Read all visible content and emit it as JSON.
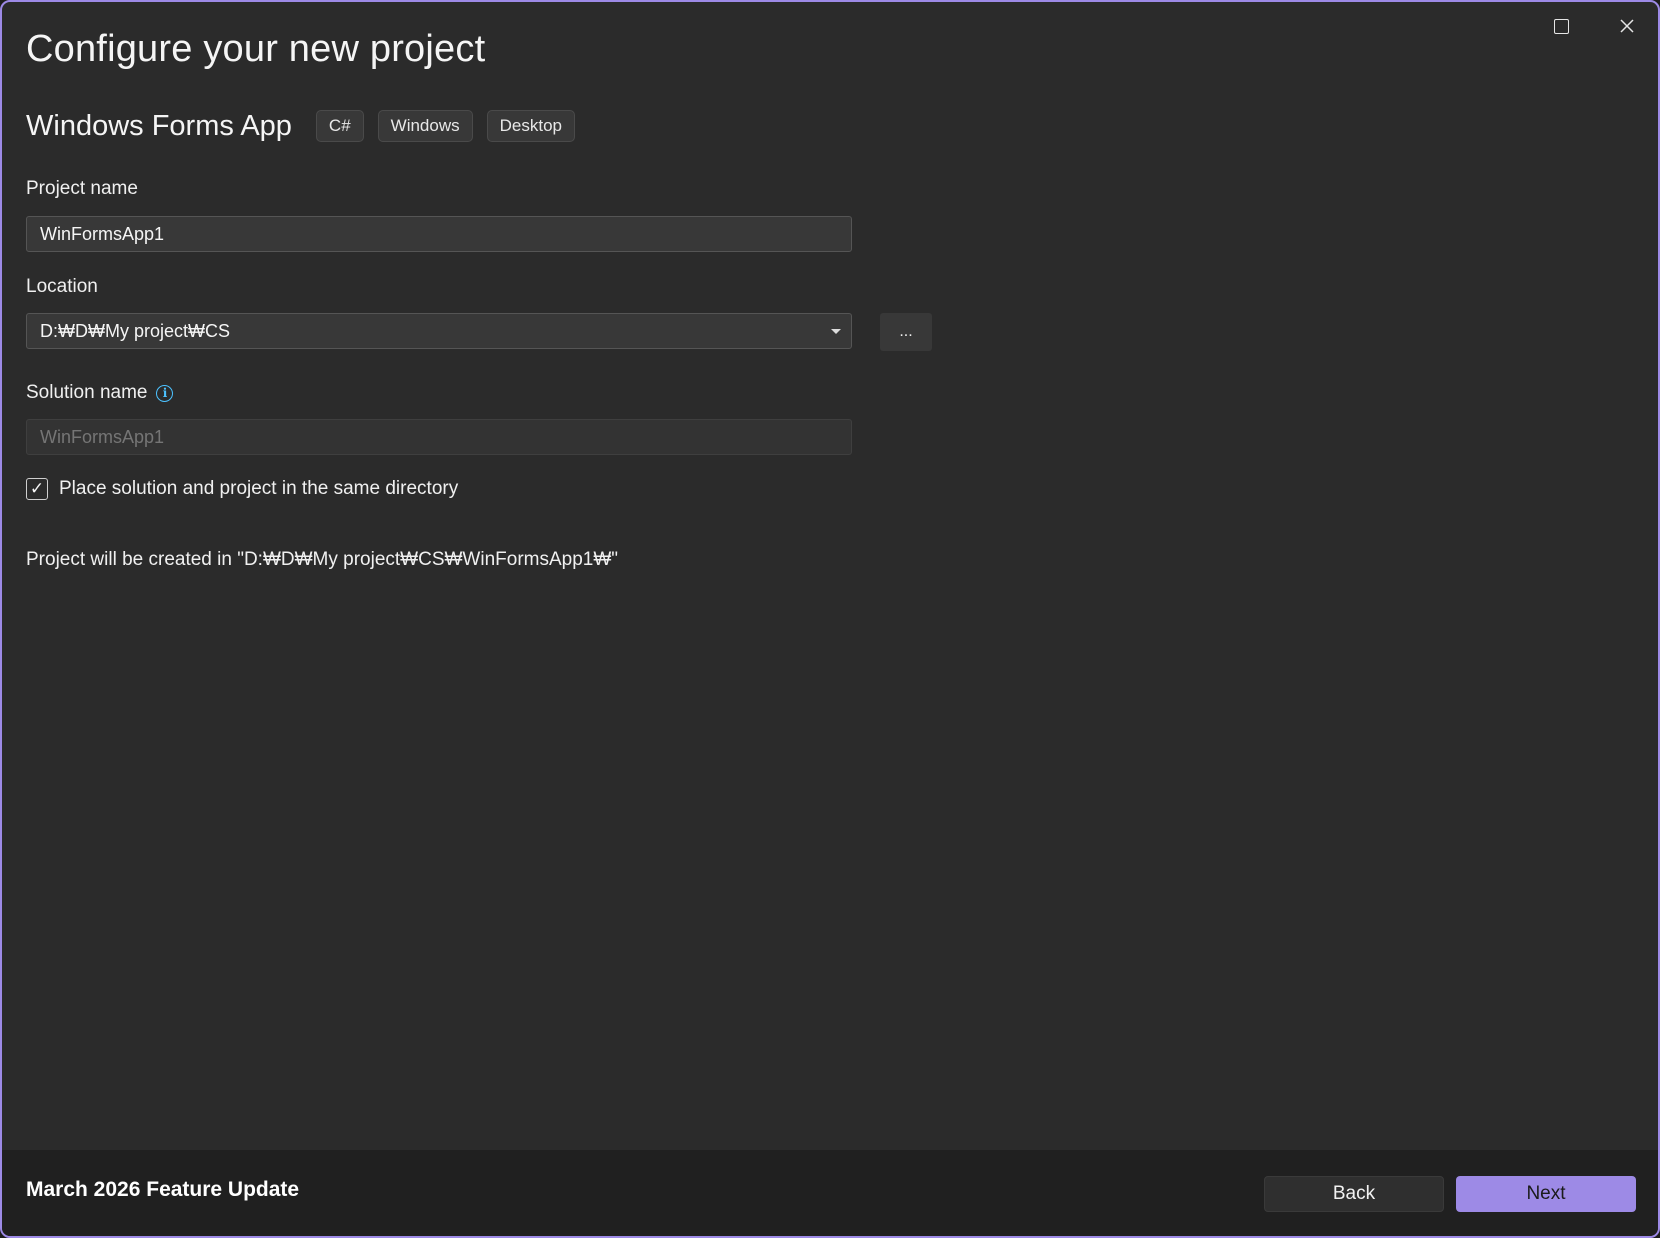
{
  "window": {
    "title": "Configure your new project",
    "maximize_icon": "maximize-icon",
    "close_icon": "close-icon"
  },
  "template": {
    "name": "Windows Forms App",
    "tags": [
      "C#",
      "Windows",
      "Desktop"
    ]
  },
  "project_name": {
    "label": "Project name",
    "value": "WinFormsApp1"
  },
  "location": {
    "label": "Location",
    "value": "D:₩D₩My project₩CS",
    "browse_label": "..."
  },
  "solution_name": {
    "label": "Solution name",
    "placeholder": "WinFormsApp1",
    "info_icon": "info-icon"
  },
  "same_directory": {
    "checked": true,
    "label": "Place solution and project in the same directory"
  },
  "created_in_text": "Project will be created in \"D:₩D₩My project₩CS₩WinFormsApp1₩\"",
  "footer": {
    "update_text": "March 2026 Feature Update",
    "back_label": "Back",
    "next_label": "Next"
  },
  "colors": {
    "accent": "#9d8ae6",
    "background": "#2b2b2b",
    "info": "#4cc2ff"
  }
}
